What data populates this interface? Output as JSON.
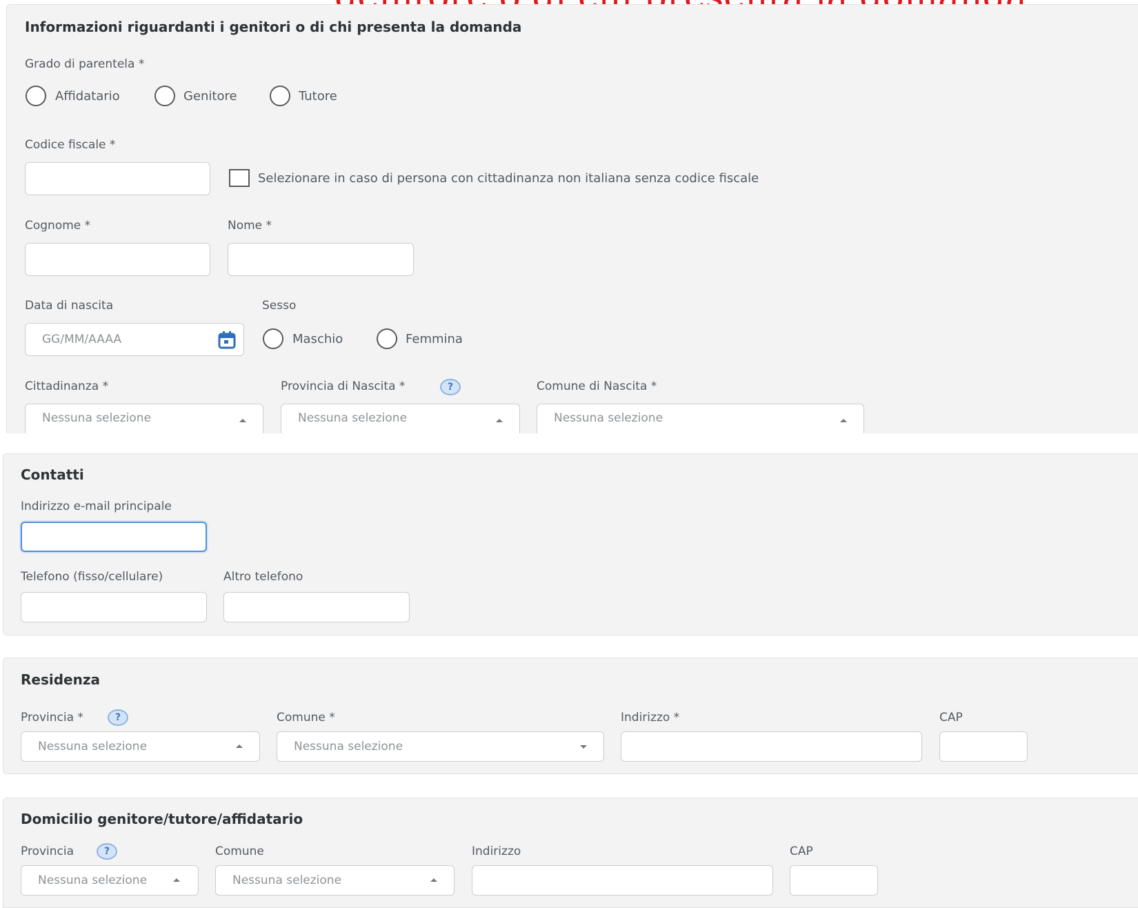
{
  "header_fragment": "genitore o di chi presenta la domanda",
  "parents": {
    "title": "Informazioni riguardanti i genitori o di chi presenta la domanda",
    "relationship_label": "Grado di parentela *",
    "relationship_options": [
      "Affidatario",
      "Genitore",
      "Tutore"
    ],
    "tax_code_label": "Codice fiscale *",
    "tax_code_value": "",
    "no_tax_code_checkbox_label": "Selezionare in caso di persona con cittadinanza non italiana senza codice fiscale",
    "surname_label": "Cognome *",
    "surname_value": "",
    "name_label": "Nome *",
    "name_value": "",
    "birth_date_label": "Data di nascita",
    "birth_date_placeholder": "GG/MM/AAAA",
    "sex_label": "Sesso",
    "sex_options": [
      "Maschio",
      "Femmina"
    ],
    "citizenship_label": "Cittadinanza *",
    "citizenship_value": "Nessuna selezione",
    "birth_province_label": "Provincia di Nascita *",
    "birth_province_value": "Nessuna selezione",
    "birth_town_label": "Comune di Nascita *",
    "birth_town_value": "Nessuna selezione"
  },
  "contacts": {
    "title": "Contatti",
    "email_label": "Indirizzo e-mail principale",
    "email_value": "",
    "phone_label": "Telefono (fisso/cellulare)",
    "phone_value": "",
    "other_phone_label": "Altro telefono",
    "other_phone_value": ""
  },
  "residence": {
    "title": "Residenza",
    "province_label": "Provincia *",
    "province_value": "Nessuna selezione",
    "town_label": "Comune *",
    "town_value": "Nessuna selezione",
    "address_label": "Indirizzo *",
    "address_value": "",
    "cap_label": "CAP",
    "cap_value": ""
  },
  "domicile": {
    "title": "Domicilio genitore/tutore/affidatario",
    "province_label": "Provincia",
    "province_value": "Nessuna selezione",
    "town_label": "Comune",
    "town_value": "Nessuna selezione",
    "address_label": "Indirizzo",
    "address_value": "",
    "cap_label": "CAP",
    "cap_value": ""
  },
  "icons": {
    "help": "?",
    "calendar": "calendar-icon"
  },
  "colors": {
    "panel_bg": "#f3f3f3",
    "focus_border": "#4d8fd6",
    "header_red": "#e0191f",
    "help_icon": "#3d79be"
  }
}
